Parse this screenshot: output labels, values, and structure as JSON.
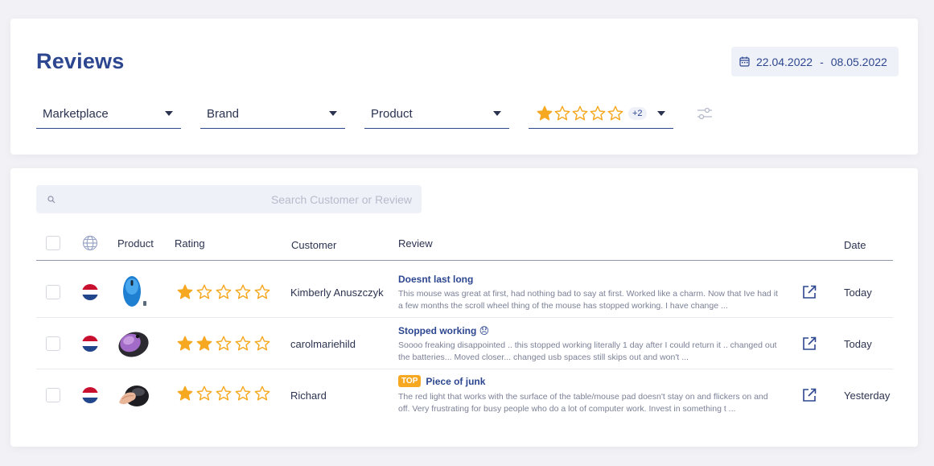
{
  "header": {
    "title": "Reviews",
    "date_from": "22.04.2022",
    "date_sep": "-",
    "date_to": "08.05.2022"
  },
  "filters": {
    "marketplace": "Marketplace",
    "brand": "Brand",
    "product": "Product",
    "rating_selected": 1,
    "rating_extra": "+2"
  },
  "search": {
    "placeholder": "Search Customer or Review",
    "value": ""
  },
  "table": {
    "columns": {
      "product": "Product",
      "rating": "Rating",
      "customer": "Customer",
      "review": "Review",
      "date": "Date"
    },
    "rows": [
      {
        "marketplace_flag": "netherlands-flag",
        "product_icon": "blue-mouse-image",
        "rating": 1,
        "customer": "Kimberly Anuszczyk",
        "title": "Doesnt last long",
        "badge": "",
        "text": "This mouse was great at first, had nothing bad to say at first. Worked like a charm. Now that Ive had it a few months the scroll wheel thing of the mouse has stopped working. I have change ...",
        "date": "Today"
      },
      {
        "marketplace_flag": "netherlands-flag",
        "product_icon": "purple-mouse-image",
        "rating": 2,
        "customer": "carolmariehild",
        "title": "Stopped working 😞",
        "badge": "",
        "text": "Soooo freaking disappointed .. this stopped working literally 1 day after I could return it .. changed out the batteries... Moved closer... changed usb spaces still skips out and won't ...",
        "date": "Today"
      },
      {
        "marketplace_flag": "netherlands-flag",
        "product_icon": "hand-on-mouse-image",
        "rating": 1,
        "customer": "Richard",
        "title": "Piece of junk",
        "badge": "TOP",
        "text": "The red light that works with the surface of the table/mouse pad doesn't stay on and flickers on and off. Very frustrating for busy people who do a lot of computer work. Invest in something t ...",
        "date": "Yesterday"
      }
    ]
  },
  "colors": {
    "accent": "#2d4690",
    "star": "#f6a821",
    "badge": "#f6a821"
  }
}
